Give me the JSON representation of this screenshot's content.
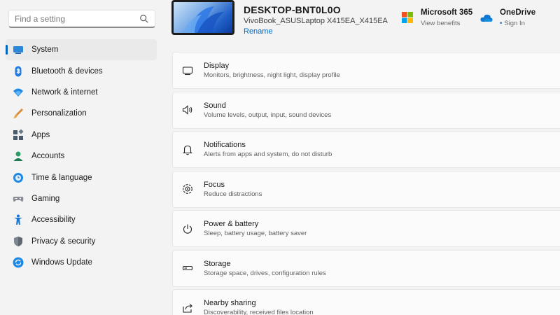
{
  "search": {
    "placeholder": "Find a setting",
    "icon": "search-icon"
  },
  "sidebar": {
    "items": [
      {
        "label": "System",
        "icon": "monitor-icon",
        "active": true
      },
      {
        "label": "Bluetooth & devices",
        "icon": "bluetooth-icon"
      },
      {
        "label": "Network & internet",
        "icon": "wifi-icon"
      },
      {
        "label": "Personalization",
        "icon": "brush-icon"
      },
      {
        "label": "Apps",
        "icon": "apps-icon"
      },
      {
        "label": "Accounts",
        "icon": "person-icon"
      },
      {
        "label": "Time & language",
        "icon": "globe-clock-icon"
      },
      {
        "label": "Gaming",
        "icon": "gamepad-icon"
      },
      {
        "label": "Accessibility",
        "icon": "accessibility-icon"
      },
      {
        "label": "Privacy & security",
        "icon": "shield-icon"
      },
      {
        "label": "Windows Update",
        "icon": "update-icon"
      }
    ]
  },
  "header": {
    "device_name": "DESKTOP-BNT0L0O",
    "device_model": "VivoBook_ASUSLaptop X415EA_X415EA",
    "rename_label": "Rename",
    "ms365": {
      "title": "Microsoft 365",
      "subtitle": "View benefits"
    },
    "onedrive": {
      "title": "OneDrive",
      "subtitle": "Sign In"
    }
  },
  "cards": [
    {
      "title": "Display",
      "subtitle": "Monitors, brightness, night light, display profile",
      "icon": "display-icon"
    },
    {
      "title": "Sound",
      "subtitle": "Volume levels, output, input, sound devices",
      "icon": "speaker-icon"
    },
    {
      "title": "Notifications",
      "subtitle": "Alerts from apps and system, do not disturb",
      "icon": "bell-icon"
    },
    {
      "title": "Focus",
      "subtitle": "Reduce distractions",
      "icon": "focus-icon"
    },
    {
      "title": "Power & battery",
      "subtitle": "Sleep, battery usage, battery saver",
      "icon": "power-icon"
    },
    {
      "title": "Storage",
      "subtitle": "Storage space, drives, configuration rules",
      "icon": "storage-icon"
    },
    {
      "title": "Nearby sharing",
      "subtitle": "Discoverability, received files location",
      "icon": "share-icon"
    }
  ],
  "colors": {
    "accent": "#0067c0",
    "background": "#f3f3f3",
    "card": "#fbfbfb"
  }
}
